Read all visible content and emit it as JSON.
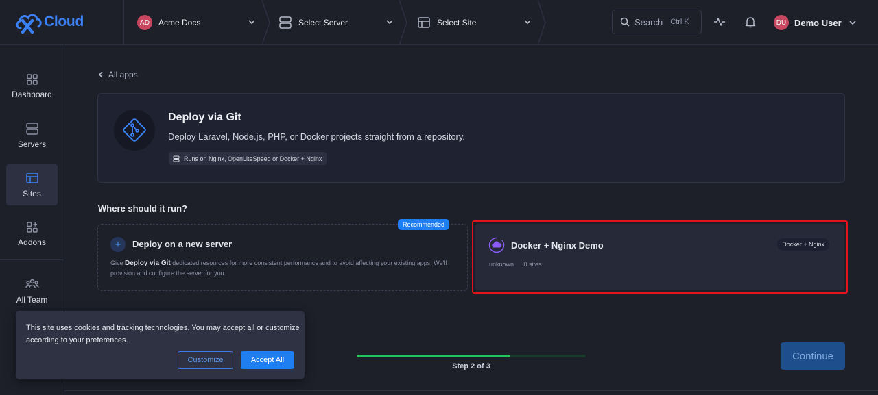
{
  "brand": {
    "logo_text": "Cloud",
    "accent": "#3b82f6"
  },
  "breadcrumbs": [
    {
      "label": "Acme Docs",
      "avatar": "AD",
      "icon": "avatar"
    },
    {
      "label": "Select Server",
      "icon": "server-icon"
    },
    {
      "label": "Select Site",
      "icon": "site-icon"
    }
  ],
  "search": {
    "label": "Search",
    "shortcut": "Ctrl K"
  },
  "user": {
    "initials": "DU",
    "name": "Demo User"
  },
  "sidebar": {
    "items": [
      {
        "label": "Dashboard",
        "icon": "dashboard-icon",
        "active": false
      },
      {
        "label": "Servers",
        "icon": "server-icon",
        "active": false
      },
      {
        "label": "Sites",
        "icon": "site-icon",
        "active": true
      },
      {
        "label": "Addons",
        "icon": "addons-icon",
        "active": false
      },
      {
        "label": "All Team",
        "icon": "team-icon",
        "active": false
      }
    ]
  },
  "back_link": "All apps",
  "app": {
    "title": "Deploy via Git",
    "description": "Deploy Laravel, Node.js, PHP, or Docker projects straight from a repository.",
    "runs_on": "Runs on Nginx, OpenLiteSpeed or Docker + Nginx"
  },
  "placement": {
    "heading": "Where should it run?",
    "new_server": {
      "badge": "Recommended",
      "title": "Deploy on a new server",
      "desc_prefix": "Give",
      "desc_app": "Deploy via Git",
      "desc_suffix": "dedicated resources for more consistent performance and to avoid affecting your existing apps. We'll provision and configure the server for you."
    },
    "existing_server": {
      "title": "Docker + Nginx Demo",
      "tag": "Docker + Nginx",
      "provider": "unknown",
      "sites": "0 sites",
      "selected": true
    }
  },
  "wizard": {
    "step_text": "Step 2 of 3",
    "progress": 0.67,
    "continue_label": "Continue"
  },
  "cookie": {
    "message": "This site uses cookies and tracking technologies. You may accept all or customize according to your preferences.",
    "customize_label": "Customize",
    "accept_label": "Accept All"
  }
}
